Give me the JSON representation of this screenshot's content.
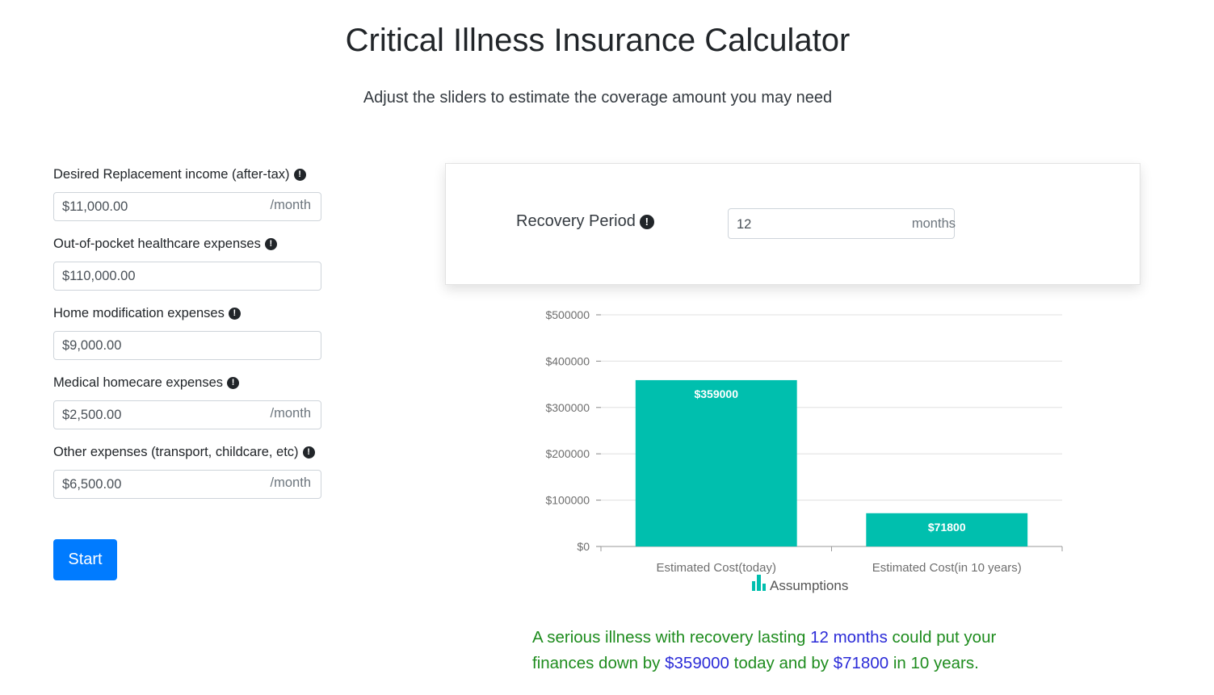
{
  "header": {
    "title": "Critical Illness Insurance Calculator",
    "subtitle": "Adjust the sliders to estimate the coverage amount you may need"
  },
  "form": {
    "fields": [
      {
        "label": "Desired Replacement income (after-tax)",
        "value": "$11,000.00",
        "suffix": "/month",
        "icon": "exclamation-circle-icon"
      },
      {
        "label": "Out-of-pocket healthcare expenses",
        "value": "$110,000.00",
        "suffix": "",
        "icon": "exclamation-circle-icon"
      },
      {
        "label": "Home modification expenses",
        "value": "$9,000.00",
        "suffix": "",
        "icon": "exclamation-circle-icon"
      },
      {
        "label": "Medical homecare expenses",
        "value": "$2,500.00",
        "suffix": "/month",
        "icon": "exclamation-circle-icon"
      },
      {
        "label": "Other expenses (transport, childcare, etc)",
        "value": "$6,500.00",
        "suffix": "/month",
        "icon": "exclamation-circle-icon"
      }
    ],
    "start_label": "Start"
  },
  "recovery": {
    "label": "Recovery Period",
    "value": "12",
    "suffix": "months"
  },
  "chart_data": {
    "type": "bar",
    "categories": [
      "Estimated Cost(today)",
      "Estimated Cost(in 10 years)"
    ],
    "values": [
      359000,
      71800
    ],
    "data_labels": [
      "$359000",
      "$71800"
    ],
    "ylim": [
      0,
      500000
    ],
    "yticks": [
      0,
      100000,
      200000,
      300000,
      400000,
      500000
    ],
    "ytick_labels": [
      "$0",
      "$100000",
      "$200000",
      "$300000",
      "$400000",
      "$500000"
    ],
    "legend": "Assumptions",
    "legend_position": "bottom",
    "grid": true,
    "bar_color": "#00bfae"
  },
  "summary": {
    "p1": "A serious illness with recovery lasting ",
    "months": "12 months",
    "p2": " could put your finances down by ",
    "today": "$359000",
    "p3": " today and by ",
    "later": "$71800",
    "p4": " in 10 years."
  },
  "colors": {
    "accent": "#007bff",
    "summary_text": "#1e8c1e",
    "summary_highlight": "#2b2bd8"
  }
}
